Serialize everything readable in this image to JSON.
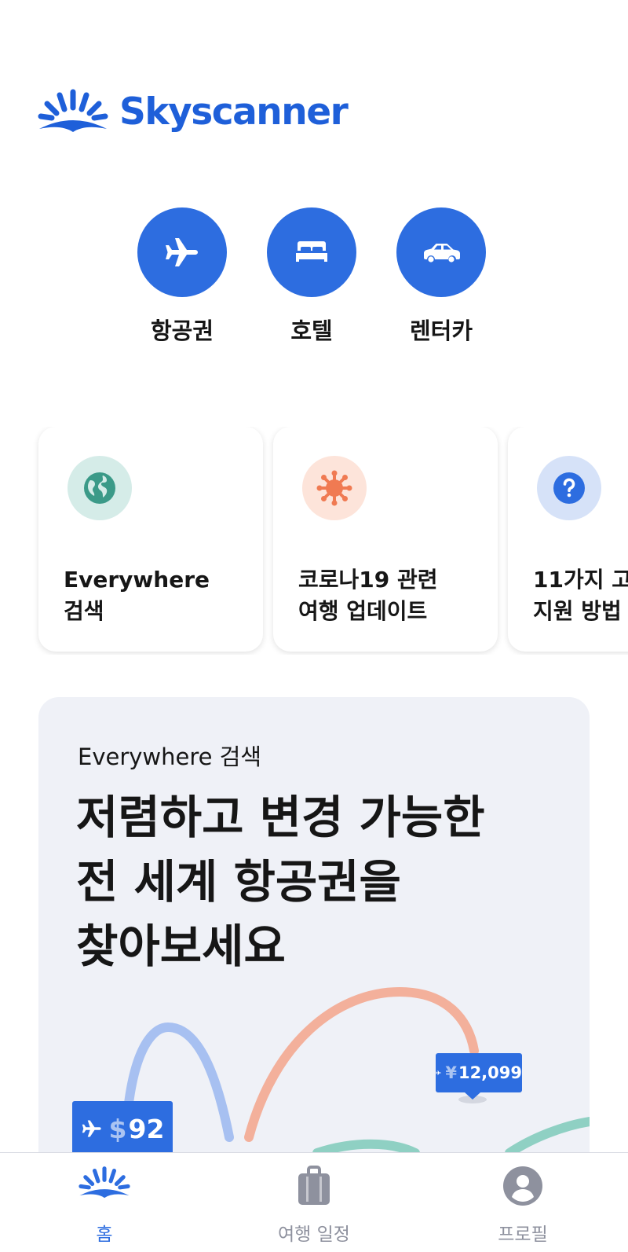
{
  "brand": {
    "name": "Skyscanner",
    "color": "#1e5fd9"
  },
  "quick_actions": [
    {
      "label": "항공권",
      "icon": "airplane-icon"
    },
    {
      "label": "호텔",
      "icon": "bed-icon"
    },
    {
      "label": "렌터카",
      "icon": "car-icon"
    }
  ],
  "cards": [
    {
      "title": "Everywhere\n검색",
      "icon": "globe-icon",
      "icon_bg": "#d5ece8",
      "icon_color": "#3b9a88"
    },
    {
      "title": "코로나19 관련\n여행 업데이트",
      "icon": "virus-icon",
      "icon_bg": "#fde4da",
      "icon_color": "#f07a52"
    },
    {
      "title": "11가지 고\n지원 방법",
      "icon": "question-icon",
      "icon_bg": "#d6e2f8",
      "icon_color": "#2d6de0"
    }
  ],
  "promo": {
    "subtitle": "Everywhere 검색",
    "title": "저렴하고 변경 가능한\n전 세계 항공권을\n찾아보세요",
    "price_tags": [
      {
        "currency": "¥",
        "amount": "12,099"
      },
      {
        "currency": "$",
        "amount": "92"
      }
    ]
  },
  "tabbar": {
    "items": [
      {
        "label": "홈",
        "icon": "skyscanner-home-icon",
        "active": true
      },
      {
        "label": "여행 일정",
        "icon": "luggage-icon",
        "active": false
      },
      {
        "label": "프로필",
        "icon": "profile-icon",
        "active": false
      }
    ]
  }
}
